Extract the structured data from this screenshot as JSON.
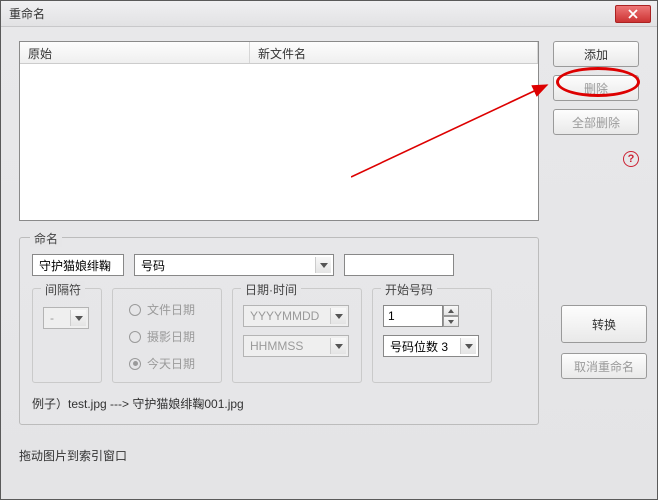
{
  "window": {
    "title": "重命名"
  },
  "list": {
    "col_original": "原始",
    "col_newname": "新文件名"
  },
  "buttons": {
    "add": "添加",
    "delete": "删除",
    "delete_all": "全部删除",
    "convert": "转换",
    "cancel_rename": "取消重命名"
  },
  "naming": {
    "group_label": "命名",
    "base_name": "守护猫娘绯鞠",
    "combo_value": "号码",
    "extra_text": "",
    "separator": {
      "label": "间隔符",
      "value": "-"
    },
    "date_source": {
      "file_date": "文件日期",
      "shoot_date": "摄影日期",
      "today": "今天日期"
    },
    "date_time": {
      "label": "日期·时间",
      "date_format": "YYYYMMDD",
      "time_format": "HHMMSS"
    },
    "start_number": {
      "label": "开始号码",
      "value": "1",
      "digits_value": "号码位数 3"
    }
  },
  "example": {
    "text": "例子）test.jpg ---> 守护猫娘绯鞠001.jpg"
  },
  "hint": {
    "text": "拖动图片到索引窗口"
  }
}
